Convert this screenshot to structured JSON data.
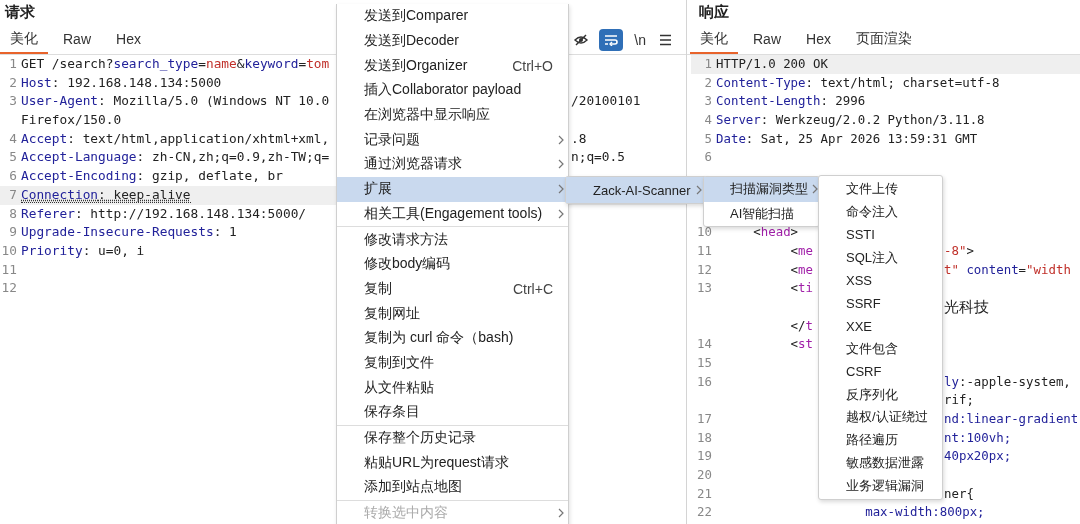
{
  "request": {
    "title": "请求",
    "tabs": [
      {
        "label": "美化",
        "selected": true
      },
      {
        "label": "Raw",
        "selected": false
      },
      {
        "label": "Hex",
        "selected": false
      }
    ],
    "toolbar": [
      {
        "kind": "eye",
        "on": false
      },
      {
        "kind": "wrap",
        "on": true
      },
      {
        "kind": "text",
        "label": "\\n",
        "on": false
      },
      {
        "kind": "lines",
        "on": false
      }
    ],
    "lines": [
      {
        "number": "1",
        "current": false,
        "underlined": false,
        "segments": [
          {
            "text": "GET /search?",
            "kind": "plain"
          },
          {
            "text": "search_type",
            "kind": "name"
          },
          {
            "text": "=",
            "kind": "plain"
          },
          {
            "text": "name",
            "kind": "value"
          },
          {
            "text": "&",
            "kind": "plain"
          },
          {
            "text": "keyword",
            "kind": "name"
          },
          {
            "text": "=",
            "kind": "plain"
          },
          {
            "text": "tom",
            "kind": "value"
          }
        ]
      },
      {
        "number": "2",
        "current": false,
        "underlined": false,
        "segments": [
          {
            "text": "Host",
            "kind": "name"
          },
          {
            "text": ": 192.168.148.134:5000",
            "kind": "plain"
          }
        ]
      },
      {
        "number": "3",
        "current": false,
        "underlined": false,
        "segments": [
          {
            "text": "User-Agent",
            "kind": "name"
          },
          {
            "text": ": Mozilla/5.0 (Windows NT 10.0",
            "kind": "plain"
          }
        ],
        "right": [
          {
            "text": "/20100101",
            "kind": "plain"
          }
        ]
      },
      {
        "current": false,
        "underlined": false,
        "segments": [
          {
            "text": "Firefox/150.0",
            "kind": "plain"
          }
        ]
      },
      {
        "number": "4",
        "current": false,
        "underlined": false,
        "segments": [
          {
            "text": "Accept",
            "kind": "name"
          },
          {
            "text": ": text/html,application/xhtml+xml,",
            "kind": "plain"
          }
        ],
        "right": [
          {
            "text": ".8",
            "kind": "plain"
          }
        ]
      },
      {
        "number": "5",
        "current": false,
        "underlined": false,
        "segments": [
          {
            "text": "Accept-Language",
            "kind": "name"
          },
          {
            "text": ": zh-CN,zh;q=0.9,zh-TW;q=",
            "kind": "plain"
          }
        ],
        "right": [
          {
            "text": "n;q=0.5",
            "kind": "plain"
          }
        ]
      },
      {
        "number": "6",
        "current": false,
        "underlined": false,
        "segments": [
          {
            "text": "Accept-Encoding",
            "kind": "name"
          },
          {
            "text": ": gzip, deflate, br",
            "kind": "plain"
          }
        ]
      },
      {
        "number": "7",
        "current": true,
        "underlined": true,
        "segments": [
          {
            "text": "Connection",
            "kind": "name"
          },
          {
            "text": ": keep-alive",
            "kind": "plain"
          }
        ]
      },
      {
        "number": "8",
        "current": false,
        "underlined": false,
        "segments": [
          {
            "text": "Referer",
            "kind": "name"
          },
          {
            "text": ": http://192.168.148.134:5000/",
            "kind": "plain"
          }
        ]
      },
      {
        "number": "9",
        "current": false,
        "underlined": false,
        "segments": [
          {
            "text": "Upgrade-Insecure-Requests",
            "kind": "name"
          },
          {
            "text": ": 1",
            "kind": "plain"
          }
        ]
      },
      {
        "number": "10",
        "current": false,
        "underlined": false,
        "segments": [
          {
            "text": "Priority",
            "kind": "name"
          },
          {
            "text": ": u=0, i",
            "kind": "plain"
          }
        ]
      },
      {
        "number": "11",
        "current": false,
        "underlined": false
      },
      {
        "number": "12",
        "current": false,
        "underlined": false
      }
    ]
  },
  "response": {
    "title": "响应",
    "tabs": [
      {
        "label": "美化",
        "selected": true
      },
      {
        "label": "Raw",
        "selected": false
      },
      {
        "label": "Hex",
        "selected": false
      },
      {
        "label": "页面渲染",
        "selected": false
      }
    ],
    "lines": [
      {
        "number": "1",
        "current": true,
        "underlined": false,
        "segments": [
          {
            "text": "HTTP/1.0 200 OK",
            "kind": "plain"
          }
        ]
      },
      {
        "number": "2",
        "current": false,
        "underlined": false,
        "segments": [
          {
            "text": "Content-Type",
            "kind": "name"
          },
          {
            "text": ": text/html; charset=utf-8",
            "kind": "plain"
          }
        ]
      },
      {
        "number": "3",
        "current": false,
        "underlined": false,
        "segments": [
          {
            "text": "Content-Length",
            "kind": "name"
          },
          {
            "text": ": 2996",
            "kind": "plain"
          }
        ]
      },
      {
        "number": "4",
        "current": false,
        "underlined": false,
        "segments": [
          {
            "text": "Server",
            "kind": "name"
          },
          {
            "text": ": Werkzeug/2.0.2 Python/3.11.8",
            "kind": "plain"
          }
        ]
      },
      {
        "number": "5",
        "current": false,
        "underlined": false,
        "segments": [
          {
            "text": "Date",
            "kind": "name"
          },
          {
            "text": ": Sat, 25 Apr 2026 13:59:31 GMT",
            "kind": "plain"
          }
        ]
      },
      {
        "number": "6",
        "current": false,
        "underlined": false
      }
    ],
    "lines_below_menu": [
      {
        "number": "10",
        "current": false,
        "underlined": false,
        "segments": [
          {
            "text": "     <",
            "kind": "plain"
          },
          {
            "text": "head",
            "kind": "tag"
          },
          {
            "text": ">",
            "kind": "plain"
          }
        ]
      },
      {
        "number": "11",
        "current": false,
        "underlined": false,
        "segments": [
          {
            "text": "          <",
            "kind": "plain"
          },
          {
            "text": "me",
            "kind": "tag"
          }
        ],
        "right": [
          {
            "text": "-8\"",
            "kind": "value"
          },
          {
            "text": ">",
            "kind": "plain"
          }
        ]
      },
      {
        "number": "12",
        "current": false,
        "underlined": false,
        "segments": [
          {
            "text": "          <",
            "kind": "plain"
          },
          {
            "text": "me",
            "kind": "tag"
          }
        ],
        "right": [
          {
            "text": "t\"",
            "kind": "value"
          },
          {
            "text": " content",
            "kind": "name"
          },
          {
            "text": "=",
            "kind": "plain"
          },
          {
            "text": "\"width",
            "kind": "value"
          }
        ]
      },
      {
        "number": "13",
        "current": false,
        "underlined": false,
        "segments": [
          {
            "text": "          <",
            "kind": "plain"
          },
          {
            "text": "ti",
            "kind": "tag"
          }
        ]
      },
      {
        "current": false,
        "underlined": false,
        "right": [
          {
            "text": "光科技",
            "kind": "cjk"
          }
        ]
      },
      {
        "current": false,
        "underlined": false,
        "segments": [
          {
            "text": "          </",
            "kind": "plain"
          },
          {
            "text": "t",
            "kind": "tag"
          }
        ]
      },
      {
        "number": "14",
        "current": false,
        "underlined": false,
        "segments": [
          {
            "text": "          <",
            "kind": "plain"
          },
          {
            "text": "st",
            "kind": "tag"
          }
        ]
      },
      {
        "number": "15",
        "current": false,
        "underlined": false
      },
      {
        "number": "16",
        "current": false,
        "underlined": false,
        "right": [
          {
            "text": "ly",
            "kind": "name"
          },
          {
            "text": ":-apple-system,",
            "kind": "plain"
          }
        ]
      },
      {
        "current": false,
        "underlined": false,
        "right": [
          {
            "text": "rif;",
            "kind": "plain"
          }
        ]
      },
      {
        "number": "17",
        "current": false,
        "underlined": false,
        "right": [
          {
            "text": "nd:linear-gradient",
            "kind": "name"
          }
        ]
      },
      {
        "number": "18",
        "current": false,
        "underlined": false,
        "right": [
          {
            "text": "nt:100vh;",
            "kind": "name"
          }
        ]
      },
      {
        "number": "19",
        "current": false,
        "underlined": false,
        "right": [
          {
            "text": "40px20px;",
            "kind": "name"
          }
        ]
      },
      {
        "number": "20",
        "current": false,
        "underlined": false
      },
      {
        "number": "21",
        "current": false,
        "underlined": false,
        "right": [
          {
            "text": "ner{",
            "kind": "plain"
          }
        ]
      },
      {
        "number": "22",
        "current": false,
        "underlined": false,
        "segments": [
          {
            "text": "                    max-width:800px;",
            "kind": "name"
          }
        ]
      }
    ]
  },
  "context_menu": {
    "groups": [
      [
        {
          "label": "发送到Comparer",
          "submenu": false,
          "selected": false,
          "disabled": false
        },
        {
          "label": "发送到Decoder",
          "submenu": false,
          "selected": false,
          "disabled": false
        },
        {
          "label": "发送到Organizer",
          "shortcut": "Ctrl+O",
          "submenu": false,
          "selected": false,
          "disabled": false
        },
        {
          "label": "插入Collaborator payload",
          "submenu": false,
          "selected": false,
          "disabled": false
        },
        {
          "label": "在浏览器中显示响应",
          "submenu": false,
          "selected": false,
          "disabled": false
        },
        {
          "label": "记录问题",
          "submenu": true,
          "selected": false,
          "disabled": false
        },
        {
          "label": "通过浏览器请求",
          "submenu": true,
          "selected": false,
          "disabled": false
        },
        {
          "label": "扩展",
          "submenu": true,
          "selected": true,
          "disabled": false
        },
        {
          "label": "相关工具(Engagement tools)",
          "submenu": true,
          "selected": false,
          "disabled": false
        }
      ],
      [
        {
          "label": "修改请求方法",
          "submenu": false,
          "selected": false,
          "disabled": false
        },
        {
          "label": "修改body编码",
          "submenu": false,
          "selected": false,
          "disabled": false
        },
        {
          "label": "复制",
          "shortcut": "Ctrl+C",
          "submenu": false,
          "selected": false,
          "disabled": false
        },
        {
          "label": "复制网址",
          "submenu": false,
          "selected": false,
          "disabled": false
        },
        {
          "label": "复制为 curl 命令（bash)",
          "submenu": false,
          "selected": false,
          "disabled": false
        },
        {
          "label": "复制到文件",
          "submenu": false,
          "selected": false,
          "disabled": false
        },
        {
          "label": "从文件粘贴",
          "submenu": false,
          "selected": false,
          "disabled": false
        },
        {
          "label": "保存条目",
          "submenu": false,
          "selected": false,
          "disabled": false
        }
      ],
      [
        {
          "label": "保存整个历史记录",
          "submenu": false,
          "selected": false,
          "disabled": false
        },
        {
          "label": "粘贴URL为request请求",
          "submenu": false,
          "selected": false,
          "disabled": false
        },
        {
          "label": "添加到站点地图",
          "submenu": false,
          "selected": false,
          "disabled": false
        }
      ],
      [
        {
          "label": "转换选中内容",
          "submenu": true,
          "selected": false,
          "disabled": true
        }
      ]
    ]
  },
  "submenus": [
    {
      "items": [
        {
          "label": "Zack-AI-Scanner",
          "submenu": true,
          "selected": true
        }
      ]
    },
    {
      "items": [
        {
          "label": "扫描漏洞类型",
          "submenu": true,
          "selected": true
        },
        {
          "label": "AI智能扫描",
          "submenu": false,
          "selected": false
        }
      ]
    },
    {
      "items": [
        {
          "label": "文件上传",
          "submenu": false,
          "selected": false
        },
        {
          "label": "命令注入",
          "submenu": false,
          "selected": false
        },
        {
          "label": "SSTI",
          "submenu": false,
          "selected": false
        },
        {
          "label": "SQL注入",
          "submenu": false,
          "selected": false
        },
        {
          "label": "XSS",
          "submenu": false,
          "selected": false
        },
        {
          "label": "SSRF",
          "submenu": false,
          "selected": false
        },
        {
          "label": "XXE",
          "submenu": false,
          "selected": false
        },
        {
          "label": "文件包含",
          "submenu": false,
          "selected": false
        },
        {
          "label": "CSRF",
          "submenu": false,
          "selected": false
        },
        {
          "label": "反序列化",
          "submenu": false,
          "selected": false
        },
        {
          "label": "越权/认证绕过",
          "submenu": false,
          "selected": false
        },
        {
          "label": "路径遍历",
          "submenu": false,
          "selected": false
        },
        {
          "label": "敏感数据泄露",
          "submenu": false,
          "selected": false
        },
        {
          "label": "业务逻辑漏洞",
          "submenu": false,
          "selected": false
        }
      ]
    }
  ]
}
